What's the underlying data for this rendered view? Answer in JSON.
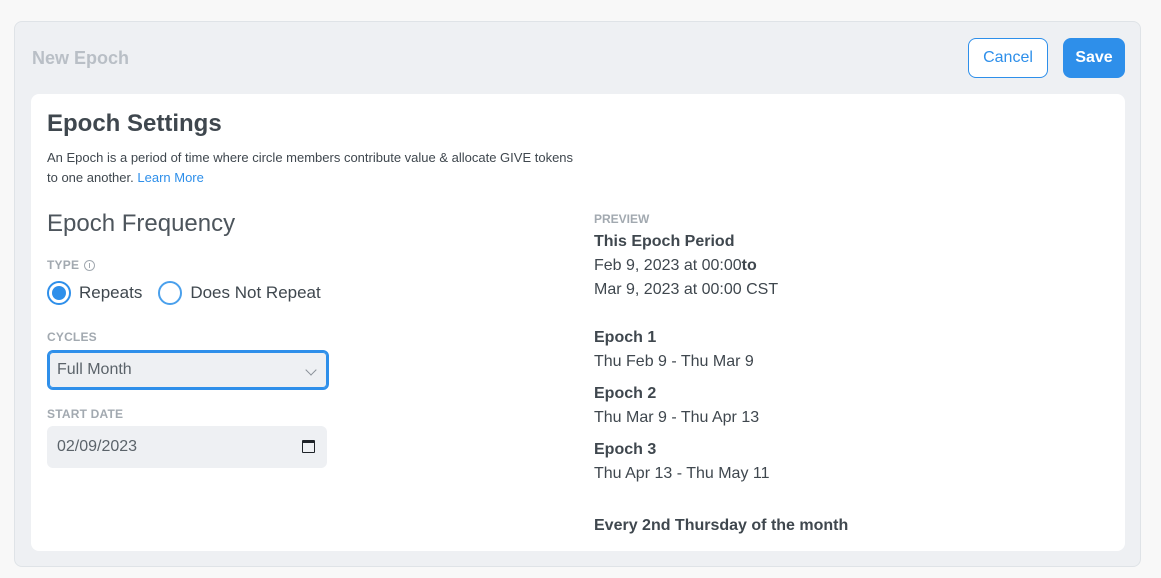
{
  "header": {
    "title": "New Epoch",
    "cancel_label": "Cancel",
    "save_label": "Save"
  },
  "settings": {
    "title": "Epoch Settings",
    "description": "An Epoch is a period of time where circle members contribute value & allocate GIVE tokens to one another.",
    "learn_more": "Learn More"
  },
  "frequency": {
    "title": "Epoch Frequency",
    "type_label": "TYPE",
    "options": [
      "Repeats",
      "Does Not Repeat"
    ],
    "selected": "Repeats",
    "cycles_label": "CYCLES",
    "cycles_value": "Full Month",
    "start_date_label": "START DATE",
    "start_date_value": "02/09/2023"
  },
  "preview": {
    "label": "PREVIEW",
    "period_title": "This Epoch Period",
    "period_start": "Feb 9, 2023 at 00:00",
    "period_to": "to",
    "period_end": "Mar 9, 2023 at 00:00 CST",
    "epochs": [
      {
        "title": "Epoch 1",
        "range": "Thu Feb 9 - Thu Mar 9"
      },
      {
        "title": "Epoch 2",
        "range": "Thu Mar 9 - Thu Apr 13"
      },
      {
        "title": "Epoch 3",
        "range": "Thu Apr 13 - Thu May 11"
      }
    ],
    "summary": "Every 2nd Thursday of the month"
  },
  "colors": {
    "accent": "#2e8fea",
    "background": "#eef0f3"
  }
}
